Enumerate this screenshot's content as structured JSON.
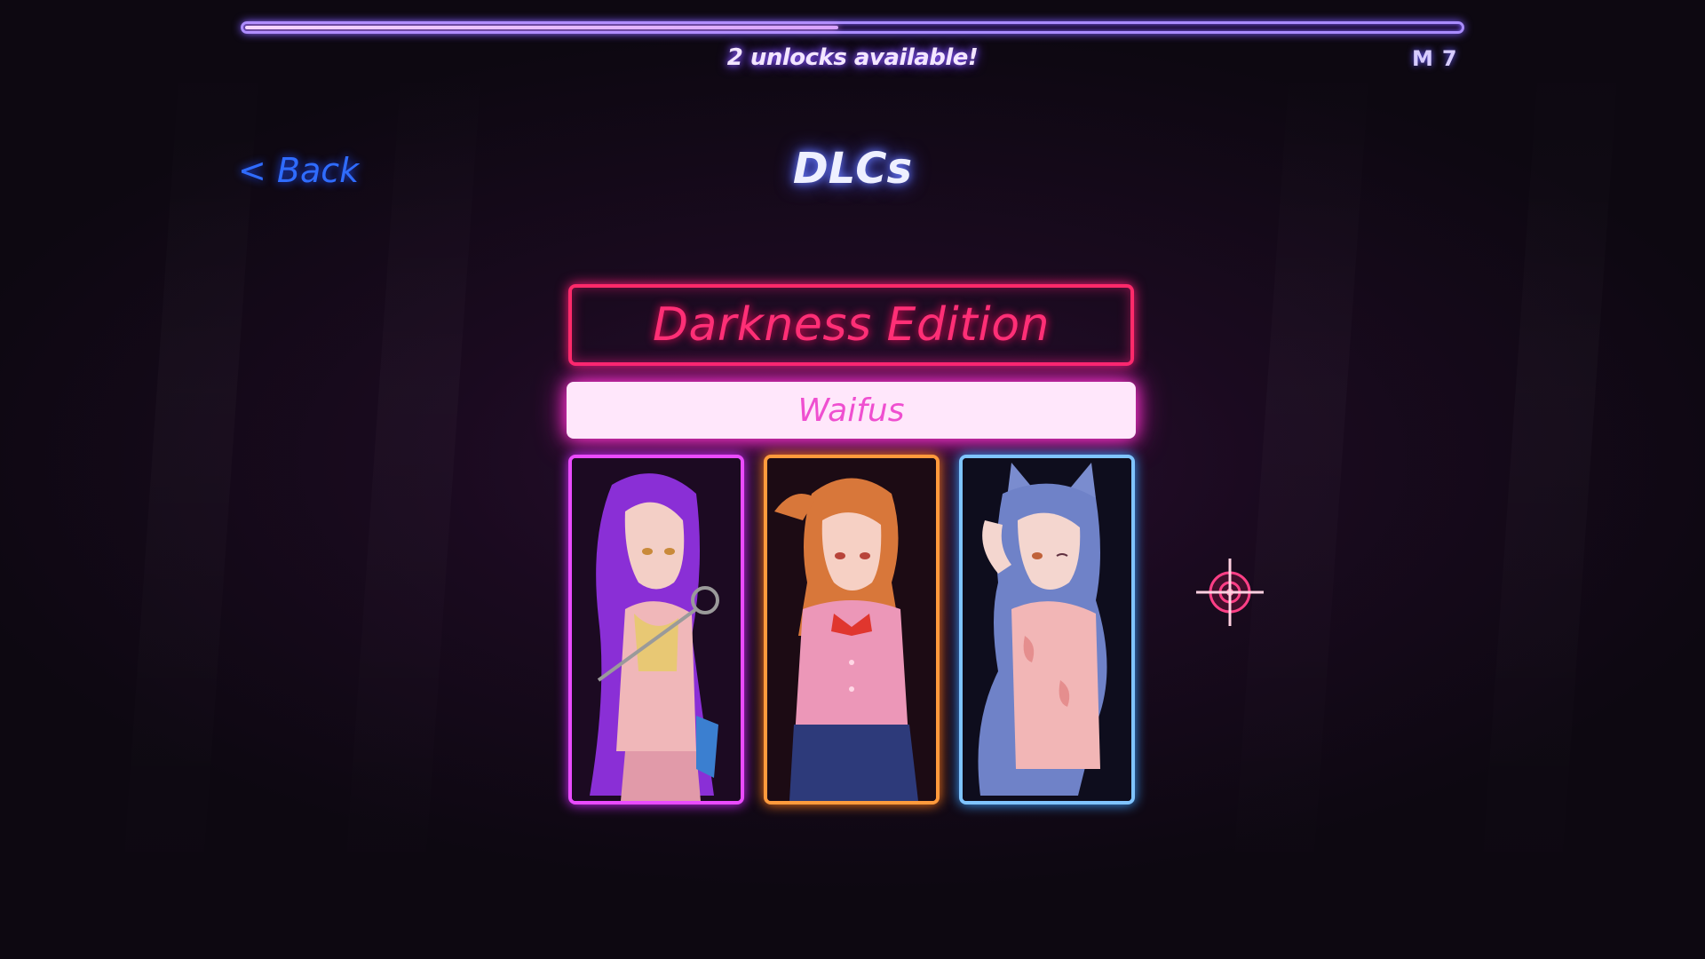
{
  "progress": {
    "fraction": 0.49,
    "label": "2 unlocks available!",
    "level_icon": "M",
    "level_value": "7"
  },
  "nav": {
    "back_label": "< Back",
    "title": "DLCs"
  },
  "dlc": {
    "name": "Darkness Edition",
    "category": "Waifus",
    "cards": [
      {
        "icon": "purple-haired-character-portrait",
        "color": "#ea4bff"
      },
      {
        "icon": "orange-haired-character-portrait",
        "color": "#ff9a3c"
      },
      {
        "icon": "catgirl-character-portrait",
        "color": "#7fc4ff"
      }
    ]
  },
  "colors": {
    "accent_pink": "#ff2a6a",
    "accent_magenta": "#ff3ad2",
    "back_blue": "#2f6cff"
  }
}
